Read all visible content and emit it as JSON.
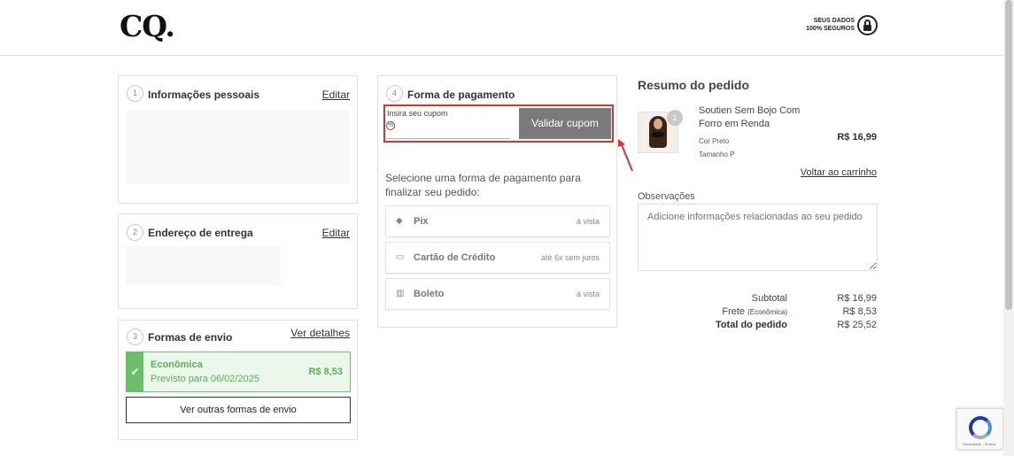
{
  "header": {
    "logo": "CQ.",
    "secure_line1": "SEUS DADOS",
    "secure_line2": "100% SEGUROS"
  },
  "personal": {
    "step": "1",
    "title": "Informações pessoais",
    "edit": "Editar"
  },
  "address": {
    "step": "2",
    "title": "Endereço de entrega",
    "edit": "Editar"
  },
  "shipping": {
    "step": "3",
    "title": "Formas de envio",
    "details": "Ver detalhes",
    "option_name": "Econômica",
    "option_date": "Previsto para 06/02/2025",
    "option_price": "R$ 8,53",
    "other_button": "Ver outras formas de envio"
  },
  "payment": {
    "step": "4",
    "title": "Forma de pagamento",
    "coupon_label": "Insira seu cupom",
    "coupon_value": "",
    "coupon_button": "Validar cupom",
    "description": "Selecione uma forma de pagamento para finalizar seu pedido:",
    "methods": [
      {
        "name": "Pix",
        "note": "à vista",
        "icon": "pix-icon"
      },
      {
        "name": "Cartão de Crédito",
        "note": "até 6x sem juros",
        "icon": "credit-card-icon"
      },
      {
        "name": "Boleto",
        "note": "à vista",
        "icon": "barcode-icon"
      }
    ]
  },
  "summary": {
    "title": "Resumo do pedido",
    "product_name": "Soutien Sem Bojo Com Forro em Renda",
    "product_qty": "1",
    "product_price": "R$ 16,99",
    "product_color": "Cor Preto",
    "product_size": "Tamanho P",
    "back_to_cart": "Voltar ao carrinho",
    "observations_label": "Observações",
    "observations_placeholder": "Adicione informações relacionadas ao seu pedido",
    "subtotal_label": "Subtotal",
    "subtotal_value": "R$ 16,99",
    "shipping_label": "Frete",
    "shipping_sub": "(Econômica)",
    "shipping_value": "R$ 8,53",
    "total_label": "Total do pedido",
    "total_value": "R$ 25,52"
  },
  "recaptcha": {
    "text": "Privacidade - Termos"
  },
  "colors": {
    "success": "#6abf69",
    "highlight": "#d9342b",
    "button_gray": "#7a7a7a"
  }
}
